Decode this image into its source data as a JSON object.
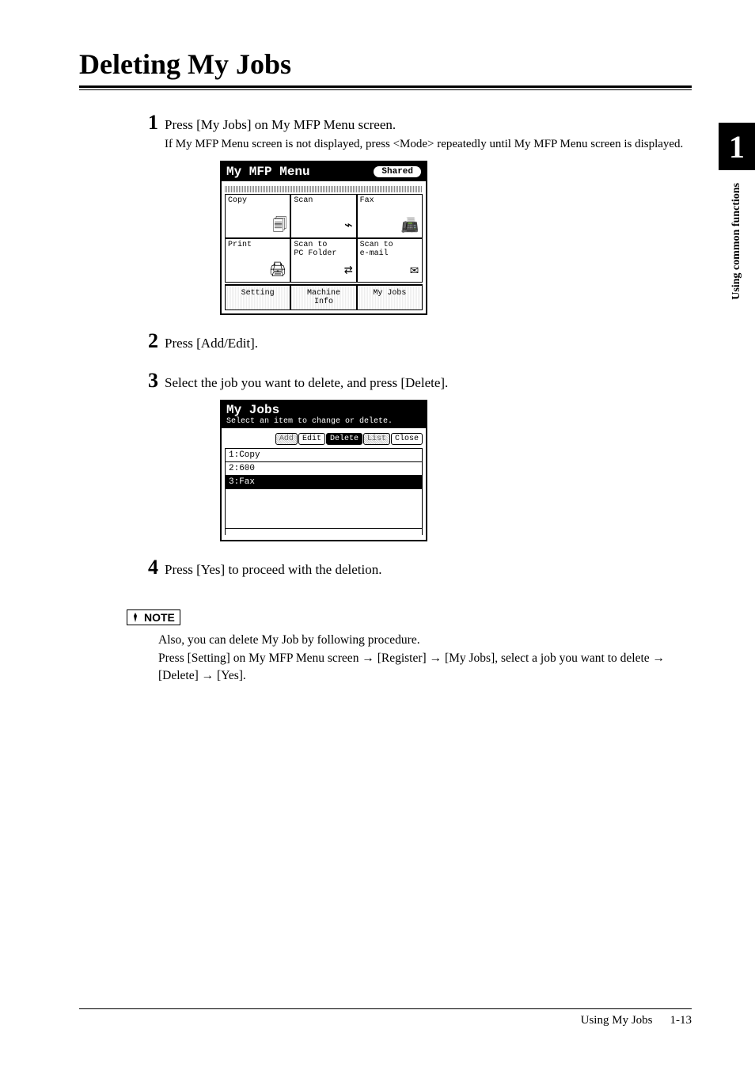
{
  "page": {
    "title": "Deleting My Jobs",
    "sidebar_chapter_number": "1",
    "sidebar_text": "Using common functions",
    "footer_section": "Using My Jobs",
    "footer_page": "1-13"
  },
  "steps": {
    "s1": {
      "num": "1",
      "text": "Press [My Jobs] on My MFP Menu screen.",
      "sub": "If My MFP Menu screen is not displayed, press <Mode> repeatedly until My MFP Menu screen is displayed."
    },
    "s2": {
      "num": "2",
      "text": "Press [Add/Edit]."
    },
    "s3": {
      "num": "3",
      "text": "Select the job you want to delete, and press [Delete]."
    },
    "s4": {
      "num": "4",
      "text": "Press [Yes] to proceed with the deletion."
    }
  },
  "lcd1": {
    "title": "My MFP Menu",
    "shared_btn": "Shared",
    "cells": {
      "copy": "Copy",
      "scan": "Scan",
      "fax": "Fax",
      "print": "Print",
      "scan_pc": "Scan to\nPC Folder",
      "scan_email": "Scan to\ne-mail"
    },
    "bottom": {
      "setting": "Setting",
      "machine": "Machine\nInfo",
      "myjobs": "My Jobs"
    }
  },
  "lcd2": {
    "title": "My Jobs",
    "subtitle": "Select an item to change or delete.",
    "toolbar": {
      "add": "Add",
      "edit": "Edit",
      "delete": "Delete",
      "list": "List",
      "close": "Close"
    },
    "rows": {
      "r1": "1:Copy",
      "r2": "2:600",
      "r3": "3:Fax"
    }
  },
  "note": {
    "label": "NOTE",
    "line1": "Also, you can delete My Job by following procedure.",
    "line2a": "Press [Setting] on My MFP Menu screen ",
    "line2b": " [Register] ",
    "line2c": " [My Jobs], select a job you want to delete ",
    "line2d": " [Delete] ",
    "line2e": " [Yes].",
    "arrow": "→"
  }
}
